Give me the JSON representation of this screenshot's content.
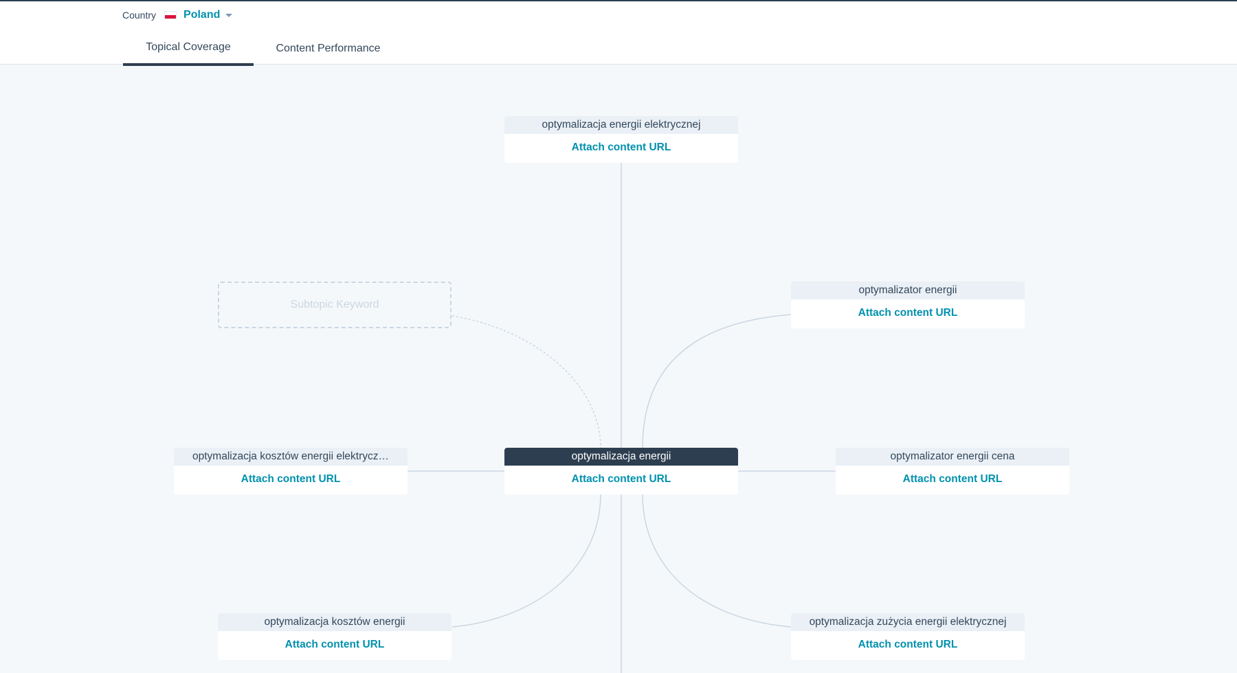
{
  "header": {
    "country_label": "Country",
    "country_value": "Poland",
    "flag_icon": "poland-flag-icon",
    "tabs": [
      {
        "label": "Topical Coverage",
        "active": true
      },
      {
        "label": "Content Performance",
        "active": false
      }
    ]
  },
  "topic_cluster": {
    "pillar": {
      "keyword": "optymalizacja energii",
      "action": "Attach content URL"
    },
    "subtopics": [
      {
        "keyword": "optymalizacja energii elektrycznej",
        "action": "Attach content URL"
      },
      {
        "keyword": "optymalizator energii",
        "action": "Attach content URL"
      },
      {
        "keyword": "optymalizator energii cena",
        "action": "Attach content URL"
      },
      {
        "keyword": "optymalizacja zużycia energii elektrycznej",
        "action": "Attach content URL"
      },
      {
        "keyword": "optymalizacja kosztów energii",
        "action": "Attach content URL"
      },
      {
        "keyword": "optymalizacja kosztów energii elektrycz…",
        "action": "Attach content URL"
      }
    ],
    "placeholder": "Subtopic Keyword"
  },
  "colors": {
    "accent": "#0091ae",
    "pillar_header": "#2d3e50",
    "node_header": "#eaf0f6",
    "canvas": "#f5f8fa",
    "edge": "#cbd6e2"
  }
}
